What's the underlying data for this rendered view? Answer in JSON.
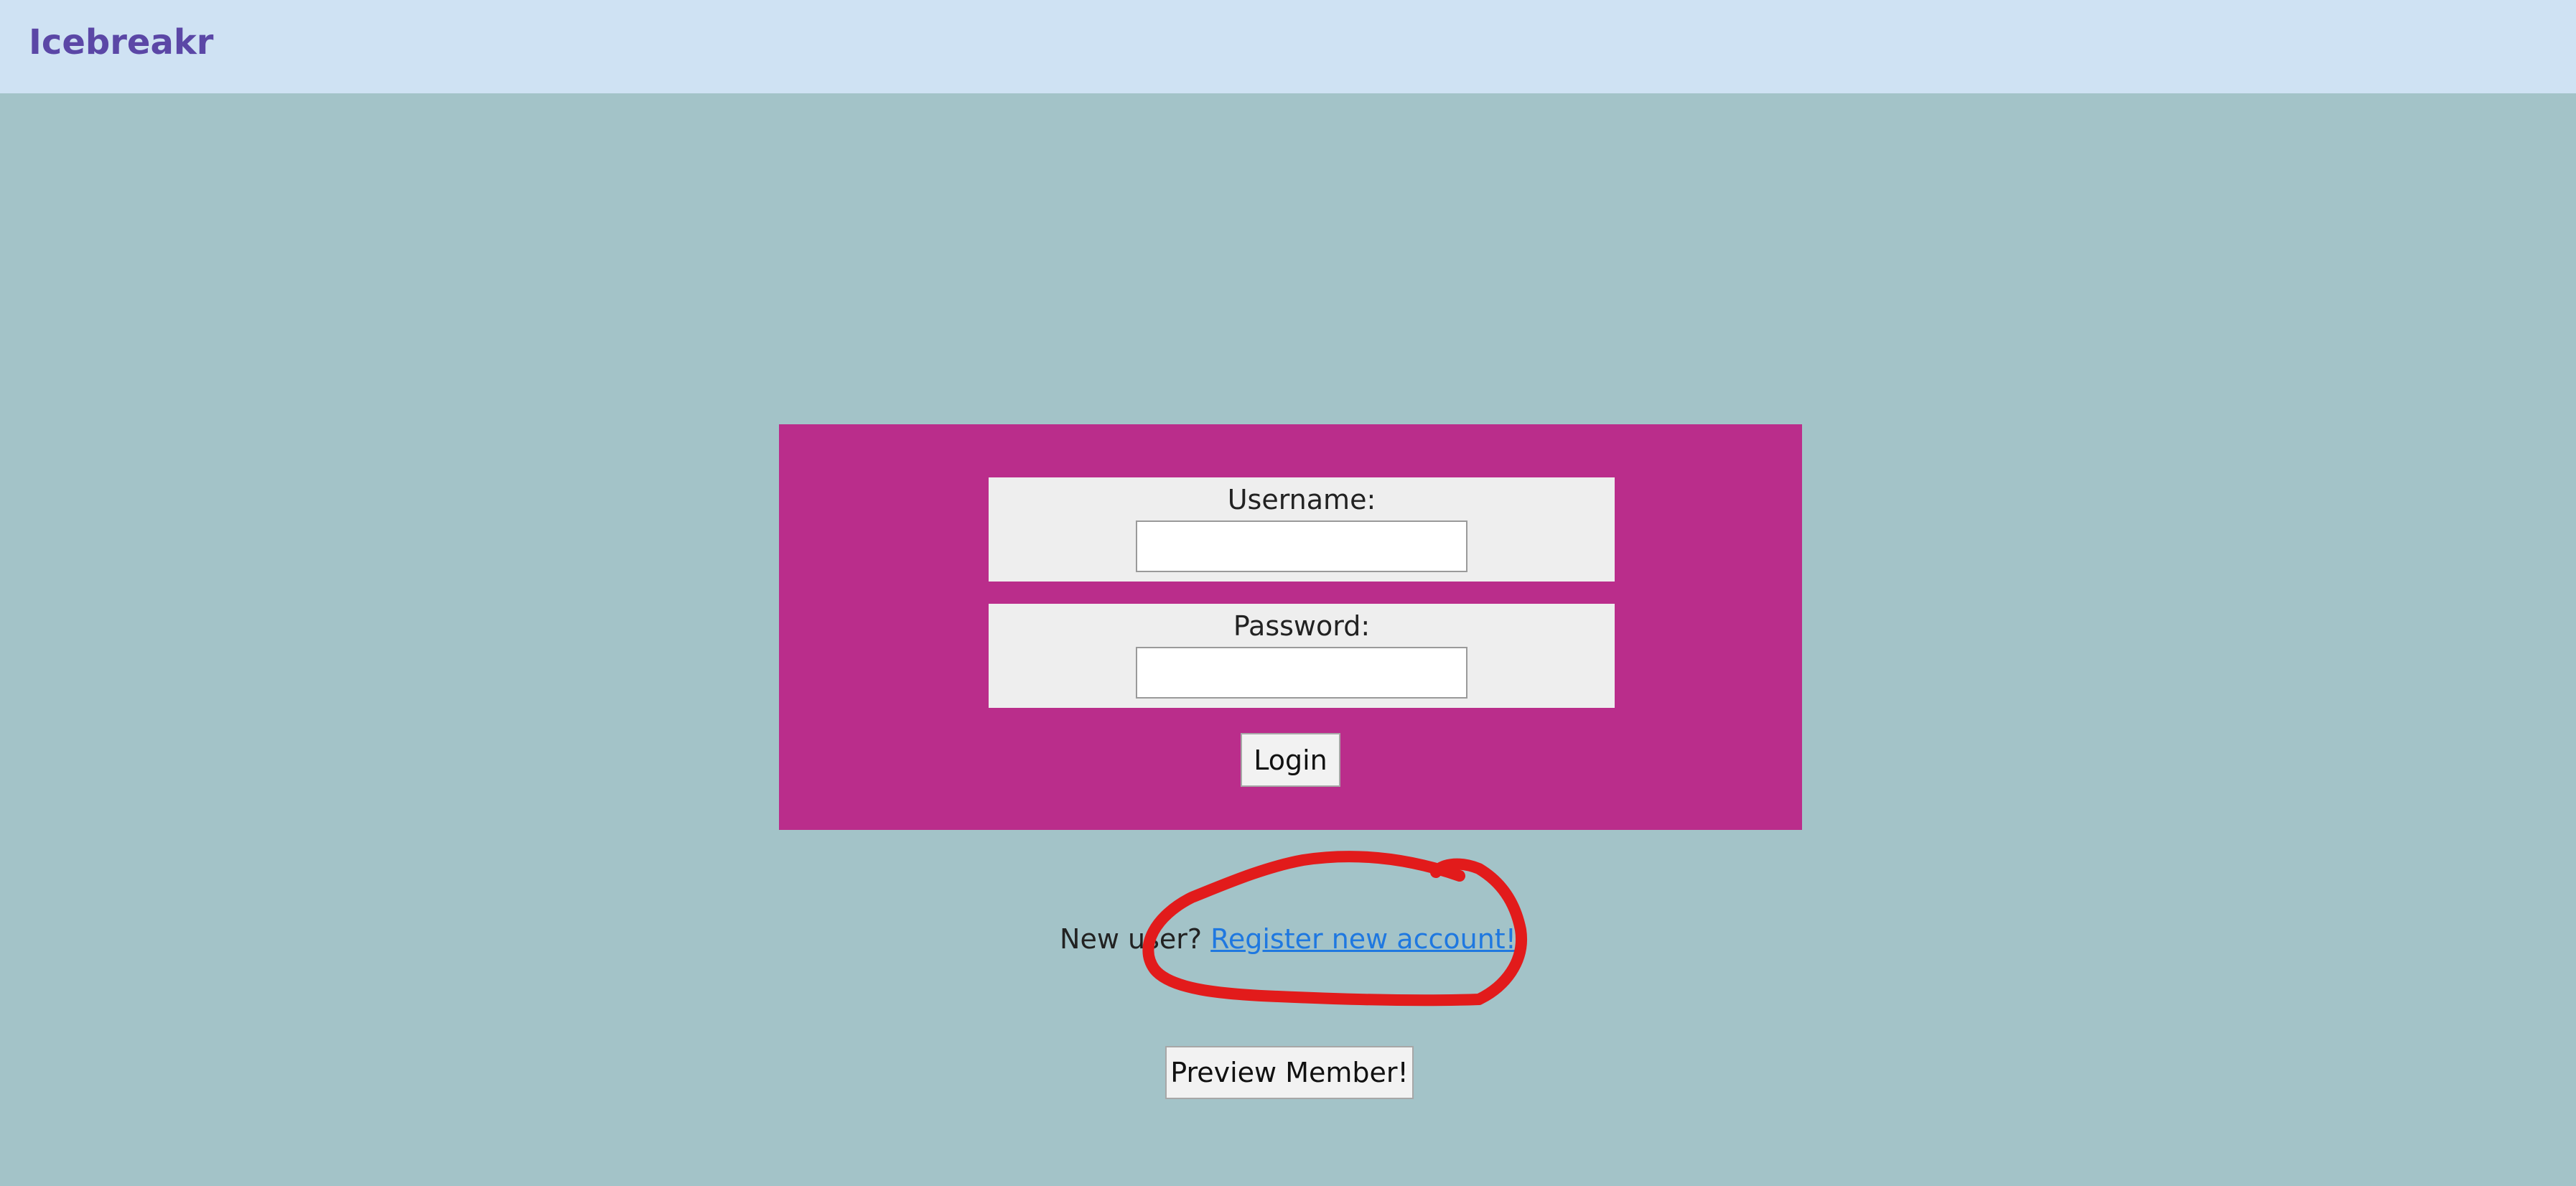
{
  "navbar": {
    "brand": "Icebreakr"
  },
  "login_form": {
    "username_label": "Username:",
    "username_value": "",
    "password_label": "Password:",
    "password_value": "",
    "login_button": "Login"
  },
  "register": {
    "prompt": "New user?",
    "link_text": "Register new account!"
  },
  "preview_button": "Preview Member!",
  "colors": {
    "page_background": "#a3c3c8",
    "navbar_background": "#cfe2f3",
    "brand_color": "#5b47a6",
    "panel_background": "#ba2d8b",
    "field_background": "#eeeeee",
    "link_color": "#1f78e0",
    "annotation_color": "#e21b1b"
  },
  "annotation": {
    "type": "hand-drawn-circle",
    "target": "register-link"
  }
}
